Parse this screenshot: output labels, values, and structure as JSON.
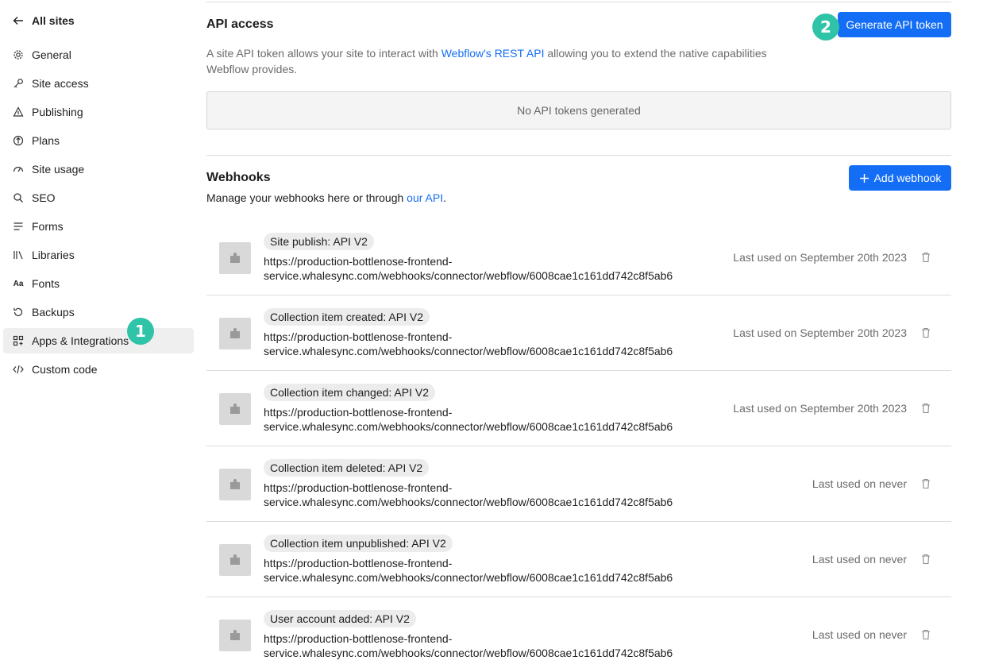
{
  "sidebar": {
    "back_label": "All sites",
    "items": [
      {
        "label": "General",
        "icon": "gear-icon"
      },
      {
        "label": "Site access",
        "icon": "key-icon"
      },
      {
        "label": "Publishing",
        "icon": "publish-icon"
      },
      {
        "label": "Plans",
        "icon": "plans-icon"
      },
      {
        "label": "Site usage",
        "icon": "gauge-icon"
      },
      {
        "label": "SEO",
        "icon": "search-icon"
      },
      {
        "label": "Forms",
        "icon": "forms-icon"
      },
      {
        "label": "Libraries",
        "icon": "libraries-icon"
      },
      {
        "label": "Fonts",
        "icon": "fonts-icon"
      },
      {
        "label": "Backups",
        "icon": "backups-icon"
      },
      {
        "label": "Apps & Integrations",
        "icon": "apps-icon",
        "active": true
      },
      {
        "label": "Custom code",
        "icon": "code-icon"
      }
    ]
  },
  "annotations": {
    "badge1": "1",
    "badge2": "2"
  },
  "api_access": {
    "title": "API access",
    "generate_button": "Generate API token",
    "desc_prefix": "A site API token allows your site to interact with ",
    "desc_link": "Webflow's REST API",
    "desc_suffix": " allowing you to extend the native capabilities Webflow provides.",
    "empty_text": "No API tokens generated"
  },
  "webhooks": {
    "title": "Webhooks",
    "add_button": "Add webhook",
    "desc_prefix": "Manage your webhooks here or through ",
    "desc_link": "our API",
    "desc_suffix": ".",
    "items": [
      {
        "trigger": "Site publish: API V2",
        "url_line1": "https://production-bottlenose-frontend-",
        "url_line2": "service.whalesync.com/webhooks/connector/webflow/6008cae1c161dd742c8f5ab6",
        "last_used": "Last used on September 20th 2023"
      },
      {
        "trigger": "Collection item created: API V2",
        "url_line1": "https://production-bottlenose-frontend-",
        "url_line2": "service.whalesync.com/webhooks/connector/webflow/6008cae1c161dd742c8f5ab6",
        "last_used": "Last used on September 20th 2023"
      },
      {
        "trigger": "Collection item changed: API V2",
        "url_line1": "https://production-bottlenose-frontend-",
        "url_line2": "service.whalesync.com/webhooks/connector/webflow/6008cae1c161dd742c8f5ab6",
        "last_used": "Last used on September 20th 2023"
      },
      {
        "trigger": "Collection item deleted: API V2",
        "url_line1": "https://production-bottlenose-frontend-",
        "url_line2": "service.whalesync.com/webhooks/connector/webflow/6008cae1c161dd742c8f5ab6",
        "last_used": "Last used on never"
      },
      {
        "trigger": "Collection item unpublished: API V2",
        "url_line1": "https://production-bottlenose-frontend-",
        "url_line2": "service.whalesync.com/webhooks/connector/webflow/6008cae1c161dd742c8f5ab6",
        "last_used": "Last used on never"
      },
      {
        "trigger": "User account added: API V2",
        "url_line1": "https://production-bottlenose-frontend-",
        "url_line2": "service.whalesync.com/webhooks/connector/webflow/6008cae1c161dd742c8f5ab6",
        "last_used": "Last used on never"
      }
    ]
  },
  "colors": {
    "accent": "#146ef5",
    "badge": "#2fc3a8",
    "active_bg": "#efefef"
  }
}
